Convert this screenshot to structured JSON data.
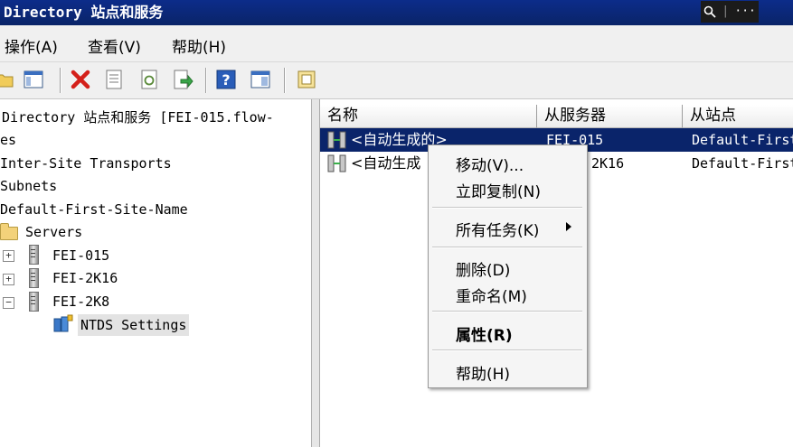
{
  "window": {
    "title": "Directory 站点和服务",
    "zoom_icon": "magnifier-icon",
    "more_label": "···"
  },
  "menu": {
    "items": [
      "操作(A)",
      "查看(V)",
      "帮助(H)"
    ]
  },
  "toolbar": {
    "icons": [
      "open-folder-icon",
      "show-pane-icon",
      "delete-icon",
      "properties-doc-icon",
      "refresh-icon",
      "export-icon",
      "help-icon",
      "filter-pane-icon",
      "new-connection-icon"
    ]
  },
  "tree": {
    "root": "Directory 站点和服务 [FEI-015.flow-",
    "sites": "es",
    "inter_site": "Inter-Site Transports",
    "subnets": "Subnets",
    "default_site": "Default-First-Site-Name",
    "servers": "Servers",
    "server1": "FEI-015",
    "server2": "FEI-2K16",
    "server3": "FEI-2K8",
    "ntds": "NTDS Settings"
  },
  "list": {
    "columns": [
      "名称",
      "从服务器",
      "从站点"
    ],
    "rows": [
      {
        "name": "<自动生成的>",
        "from_server": "FEI-015",
        "from_site": "Default-First"
      },
      {
        "name": "<自动生成",
        "from_server": "2K16",
        "from_site": "Default-First"
      }
    ]
  },
  "context_menu": {
    "move": "移动(V)...",
    "replicate_now": "立即复制(N)",
    "all_tasks": "所有任务(K)",
    "delete": "删除(D)",
    "rename": "重命名(M)",
    "properties": "属性(R)",
    "help": "帮助(H)"
  },
  "colors": {
    "title_bar": "#0a2468",
    "selection": "#0a246a",
    "delete_red": "#d4201a"
  }
}
